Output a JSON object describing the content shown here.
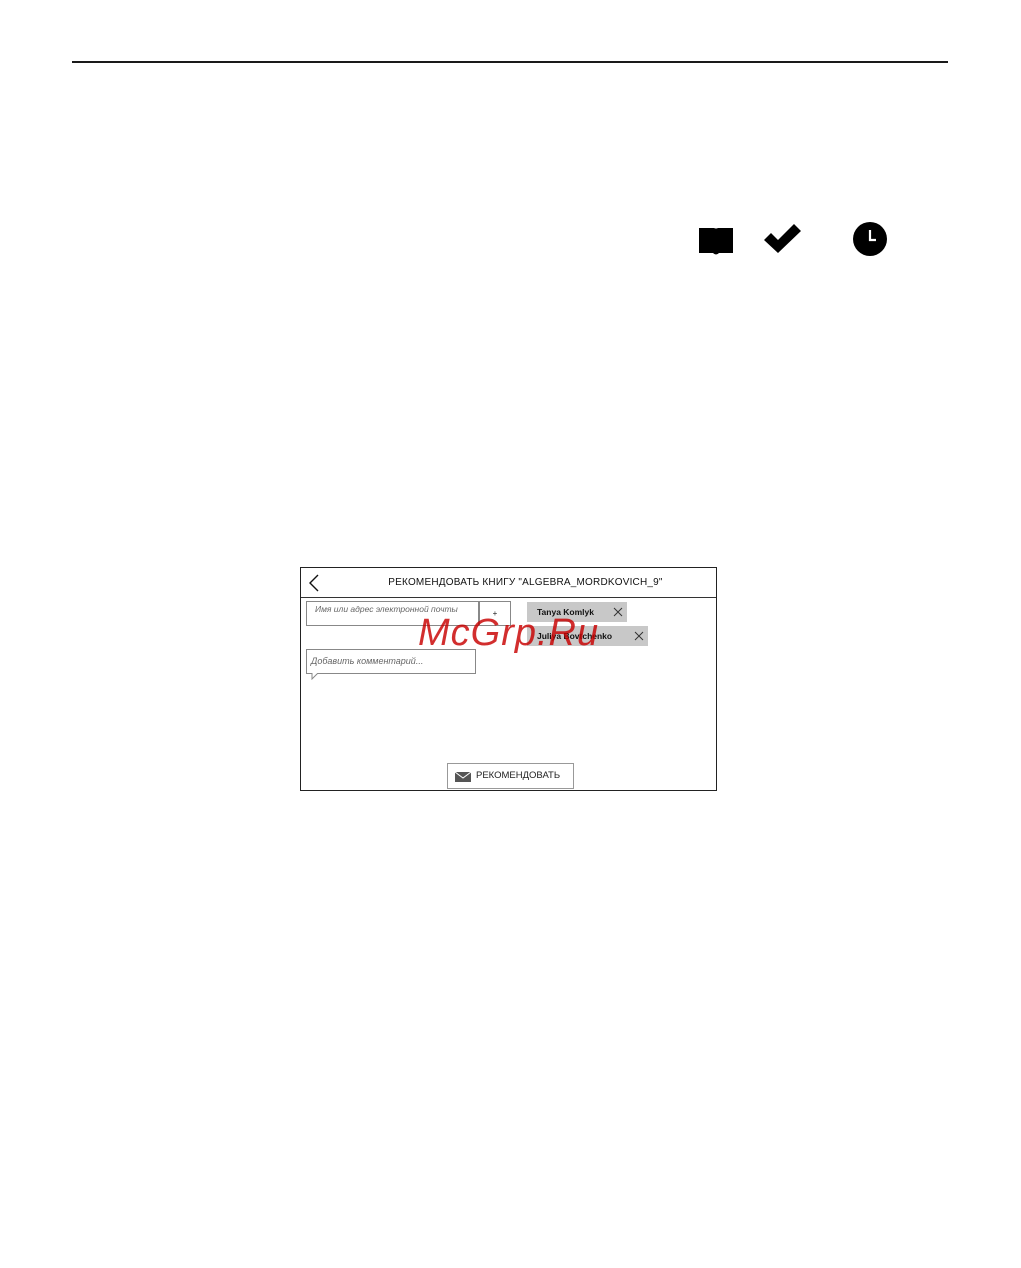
{
  "icons": {
    "book": "book-icon",
    "check": "check-icon",
    "clock": "clock-icon"
  },
  "dialog": {
    "title": "РЕКОМЕНДОВАТЬ КНИГУ \"ALGEBRA_MORDKOVICH_9\"",
    "recipient_placeholder": "Имя или адрес электронной почты",
    "add_button_label": "+",
    "recipients": [
      {
        "name": "Tanya Komlyk"
      },
      {
        "name": "Juliya Bovtchenko"
      }
    ],
    "comment_placeholder": "Добавить комментарий...",
    "submit_label": "РЕКОМЕНДОВАТЬ"
  },
  "watermark": "McGrp.Ru",
  "colors": {
    "chip_background": "#c8c8c8",
    "watermark": "#c80000",
    "border": "#222222"
  }
}
